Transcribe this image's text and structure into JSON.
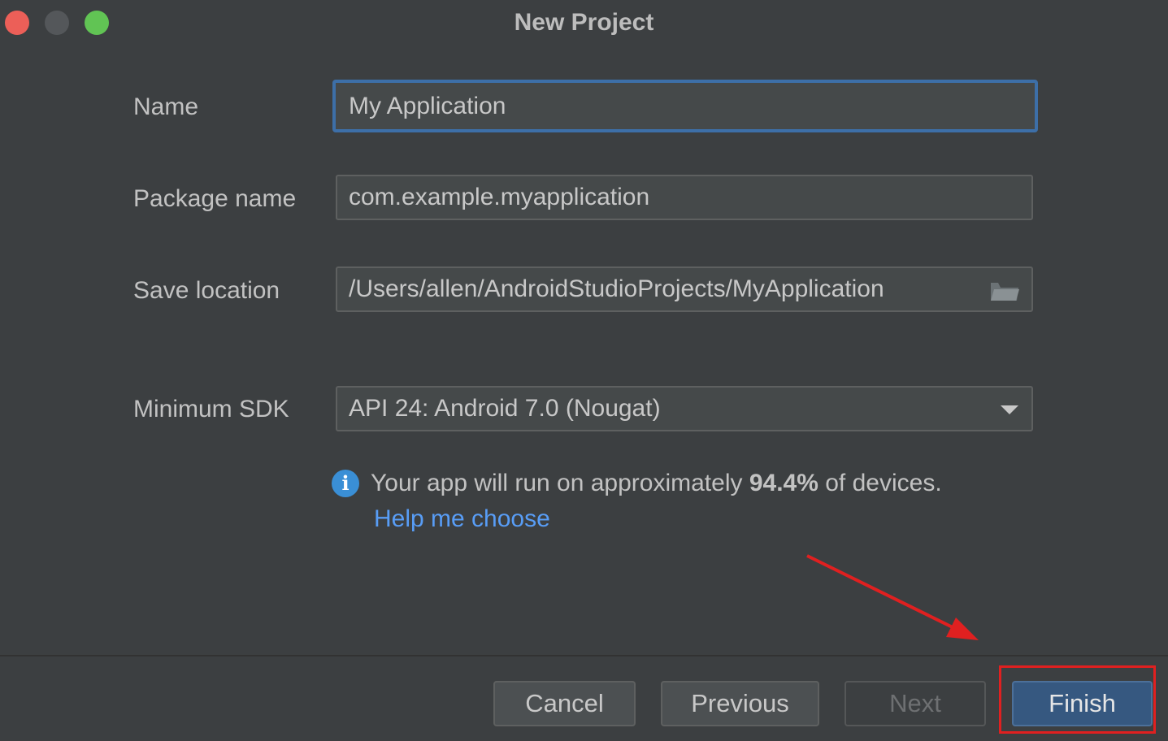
{
  "window": {
    "title": "New Project"
  },
  "form": {
    "name": {
      "label": "Name",
      "value": "My Application"
    },
    "package": {
      "label": "Package name",
      "value": "com.example.myapplication"
    },
    "location": {
      "label": "Save location",
      "value": "/Users/allen/AndroidStudioProjects/MyApplication",
      "icon": "folder-icon"
    },
    "min_sdk": {
      "label": "Minimum SDK",
      "value": "API 24: Android 7.0 (Nougat)",
      "icon": "chevron-down-icon"
    }
  },
  "info": {
    "icon": "info-icon",
    "text_before": "Your app will run on approximately ",
    "percent": "94.4%",
    "text_after": " of devices.",
    "help_link": "Help me choose"
  },
  "buttons": {
    "cancel": "Cancel",
    "previous": "Previous",
    "next": "Next",
    "finish": "Finish"
  },
  "colors": {
    "accent": "#365880",
    "focus_border": "#3d6fa8",
    "link": "#589df6",
    "annotation": "#e02020"
  }
}
